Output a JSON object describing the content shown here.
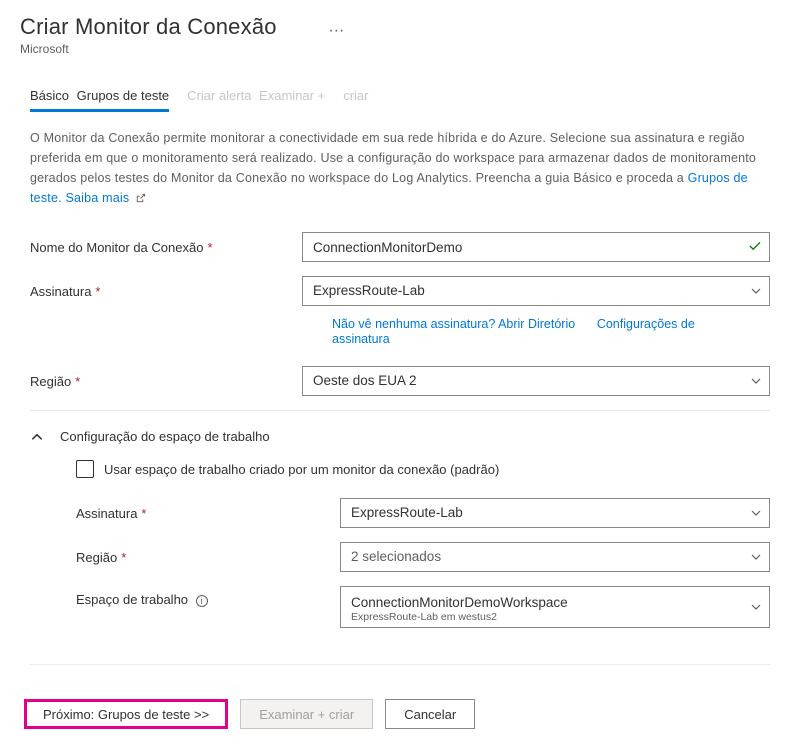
{
  "header": {
    "title": "Criar Monitor da Conexão",
    "subtitle": "Microsoft",
    "ellipsis": "···"
  },
  "tabs": {
    "basic": "Básico",
    "groups": "Grupos de teste",
    "alert": "Criar alerta",
    "review": "Examinar +",
    "create": "criar"
  },
  "description": {
    "text": "O Monitor da Conexão permite monitorar a conectividade em sua rede híbrida e do Azure. Selecione sua assinatura e região preferida em que o monitoramento será realizado. Use a configuração do workspace para armazenar dados de monitoramento gerados pelos testes do Monitor da Conexão no workspace do Log Analytics. Preencha a guia Básico e proceda a",
    "link": "Grupos de teste. Saiba mais"
  },
  "form": {
    "name_label": "Nome do Monitor da Conexão",
    "name_value": "ConnectionMonitorDemo",
    "sub_label": "Assinatura",
    "sub_value": "ExpressRoute-Lab",
    "no_sub_link": "Não vê nenhuma assinatura? Abrir Diretório",
    "sub_settings_link": "Configurações de assinatura",
    "region_label": "Região",
    "region_value": "Oeste dos EUA 2"
  },
  "workspace": {
    "section_title": "Configuração do espaço de trabalho",
    "checkbox_label": "Usar espaço de trabalho criado por um monitor da conexão (padrão)",
    "sub_label": "Assinatura",
    "sub_value": "ExpressRoute-Lab",
    "region_label": "Região",
    "region_value": "2 selecionados",
    "ws_label": "Espaço de trabalho",
    "ws_value": "ConnectionMonitorDemoWorkspace",
    "ws_sub": "ExpressRoute-Lab em westus2"
  },
  "footer": {
    "next": "Próximo: Grupos de teste >>",
    "review": "Examinar + criar",
    "cancel": "Cancelar"
  }
}
